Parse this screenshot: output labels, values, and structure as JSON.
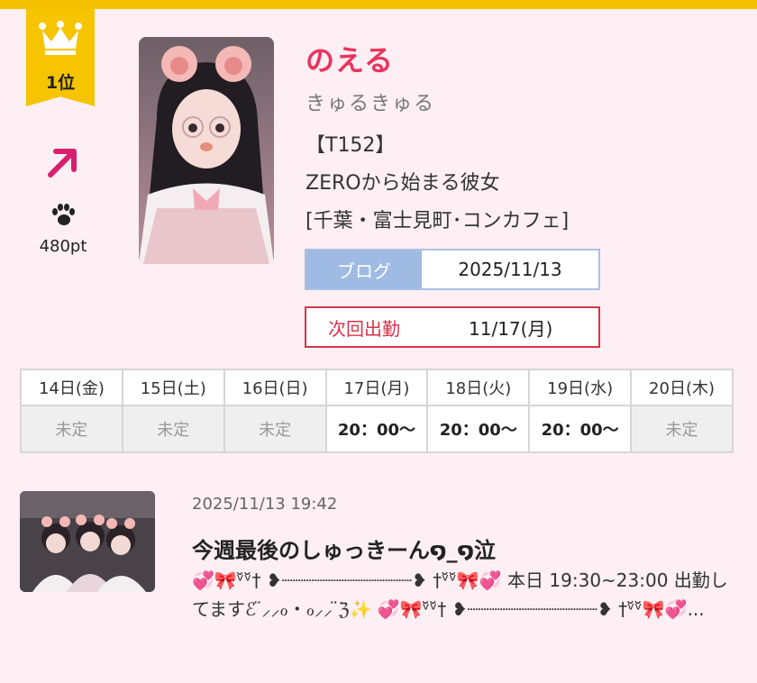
{
  "ranking": {
    "rank_label": "1位",
    "trend": "up-right",
    "points": "480pt"
  },
  "profile": {
    "name": "のえる",
    "catchphrase": "きゅるきゅる",
    "height": "【T152】",
    "shop": "ZEROから始まる彼女",
    "area": "[千葉・富士見町･コンカフェ]"
  },
  "blog_box": {
    "label": "ブログ",
    "date": "2025/11/13"
  },
  "next_work": {
    "label": "次回出勤",
    "date": "11/17(月)"
  },
  "schedule": {
    "days": [
      {
        "label": "14日(金)",
        "time": "未定"
      },
      {
        "label": "15日(土)",
        "time": "未定"
      },
      {
        "label": "16日(日)",
        "time": "未定"
      },
      {
        "label": "17日(月)",
        "time": "20：00〜"
      },
      {
        "label": "18日(火)",
        "time": "20：00〜"
      },
      {
        "label": "19日(水)",
        "time": "20：00〜"
      },
      {
        "label": "20日(木)",
        "time": "未定"
      }
    ]
  },
  "latest_post": {
    "datetime": "2025/11/13 19:42",
    "title": "今週最後のしゅっきーん໑_໑泣",
    "excerpt": "💞🎀ᵛ̆ᵛ̆† ❥┈┈┈┈┈┈┈┈┈┈┈┈❥ †ᵛ̆ᵛ̆🎀💞 本日 19:30~23:00 出勤してますℰ ̈⸝⸝ℴ・ℴ⸝⸝ ̈ℨ✨ 💞🎀ᵛ̆ᵛ̆† ❥┈┈┈┈┈┈┈┈┈┈┈┈❥ †ᵛ̆ᵛ̆🎀💞..."
  },
  "colors": {
    "top_bar": "#f5c200",
    "badge": "#f6c400",
    "name": "#e8355f",
    "arrow": "#d81e6e",
    "blog_label_bg": "#9fbbe3",
    "next_border": "#d9334a",
    "saturday": "#2eb7b0",
    "sunday": "#e57fa3"
  },
  "icons": {
    "crown": "crown-icon",
    "trend": "trend-up-arrow-icon",
    "paw": "paw-icon"
  }
}
